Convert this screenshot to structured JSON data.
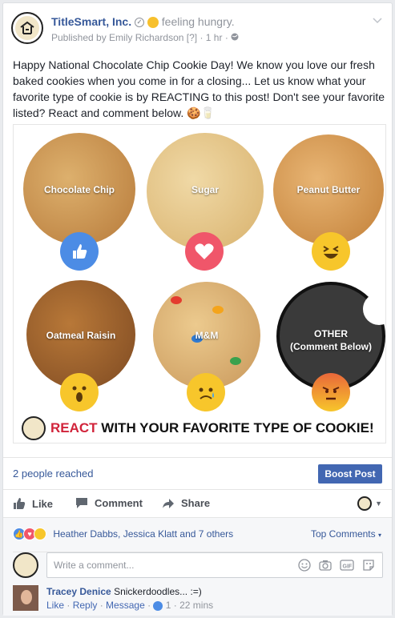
{
  "post": {
    "page_name": "TitleSmart, Inc.",
    "feeling": "feeling hungry.",
    "published_by": "Published by Emily Richardson",
    "bracket": "[?]",
    "time": "1 hr",
    "separator": "·",
    "body": "Happy National Chocolate Chip Cookie Day! We know you love our fresh baked cookies when you come in for a closing... Let us know what your favorite type of cookie is by REACTING to this post! Don't see your favorite listed? React and comment below. 🍪🥛"
  },
  "image": {
    "cookies": [
      {
        "label": "Chocolate Chip",
        "reaction": "like-icon",
        "color": "#c99252"
      },
      {
        "label": "Sugar",
        "reaction": "love-icon",
        "color": "#e5c689"
      },
      {
        "label": "Peanut Butter",
        "reaction": "haha-icon",
        "color": "#d79a4f"
      },
      {
        "label": "Oatmeal Raisin",
        "reaction": "wow-icon",
        "color": "#a0612e"
      },
      {
        "label": "M&M",
        "reaction": "sad-icon",
        "color": "#e0b877"
      },
      {
        "label_line1": "OTHER",
        "label_line2": "(Comment Below)",
        "reaction": "angry-icon",
        "color": "#3a3a3a"
      }
    ],
    "banner_red": "REACT",
    "banner_rest": " WITH YOUR FAVORITE TYPE OF COOKIE!"
  },
  "stats": {
    "reached": "2 people reached",
    "boost_label": "Boost Post"
  },
  "actions": {
    "like": "Like",
    "comment": "Comment",
    "share": "Share"
  },
  "reactions": {
    "names": "Heather Dabbs, Jessica Klatt and 7 others",
    "top_comments": "Top Comments"
  },
  "comment_box": {
    "placeholder": "Write a comment..."
  },
  "reply": {
    "author": "Tracey Denice",
    "text": "Snickerdoodles... :=)",
    "like": "Like",
    "reply": "Reply",
    "message": "Message",
    "like_count": "1",
    "time": "22 mins"
  },
  "colors": {
    "link": "#365899",
    "boost": "#4267b2",
    "banner_red": "#d1233a"
  }
}
